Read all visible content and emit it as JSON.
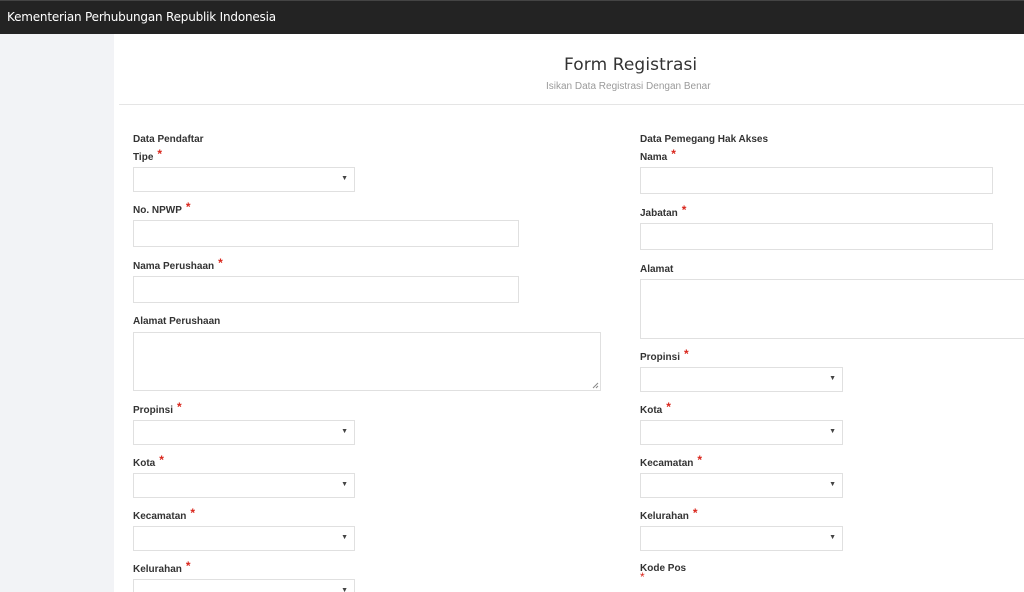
{
  "app": {
    "title": "Kementerian Perhubungan Republik Indonesia"
  },
  "form": {
    "title": "Form Registrasi",
    "subtitle": "Isikan Data Registrasi Dengan Benar"
  },
  "left": {
    "section": "Data Pendaftar",
    "tipe": "Tipe",
    "npwp": "No. NPWP",
    "nama_perusahaan": "Nama Perushaan",
    "alamat_perusahaan": "Alamat Perushaan",
    "propinsi": "Propinsi",
    "kota": "Kota",
    "kecamatan": "Kecamatan",
    "kelurahan": "Kelurahan"
  },
  "right": {
    "section": "Data Pemegang Hak Akses",
    "nama": "Nama",
    "jabatan": "Jabatan",
    "alamat": "Alamat",
    "propinsi": "Propinsi",
    "kota": "Kota",
    "kecamatan": "Kecamatan",
    "kelurahan": "Kelurahan",
    "kode_pos": "Kode Pos"
  },
  "required_marker": "*",
  "dropdown_caret": "▼",
  "colors": {
    "topbar": "#232323",
    "required": "#d9261c"
  }
}
